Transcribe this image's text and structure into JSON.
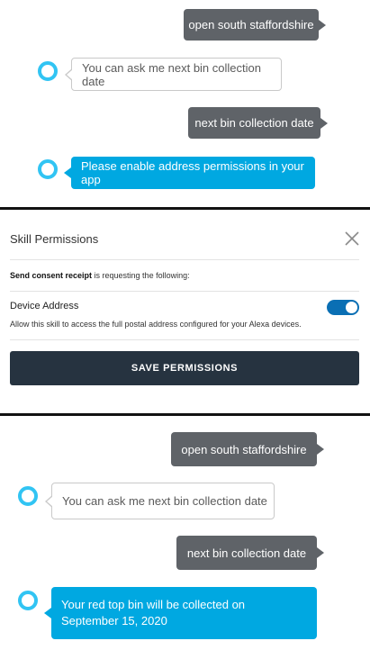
{
  "chat_top": {
    "user_msg_1": "open south staffordshire",
    "alexa_msg_1": "You can ask me next bin collection date",
    "user_msg_2": "next bin collection date",
    "alexa_msg_2": "Please enable address permissions in your app"
  },
  "permissions": {
    "title": "Skill Permissions",
    "skill_name": "Send consent receipt",
    "requesting_text": " is requesting the following:",
    "permission_name": "Device Address",
    "permission_desc": "Allow this skill to access the full postal address configured for your Alexa devices.",
    "toggle_on": true,
    "save_label": "SAVE PERMISSIONS"
  },
  "chat_bottom": {
    "user_msg_1": "open south staffordshire",
    "alexa_msg_1": "You can ask me next bin collection date",
    "user_msg_2": "next bin collection date",
    "alexa_msg_2_line1": "Your red top bin will be collected on",
    "alexa_msg_2_line2": "September 15, 2020"
  },
  "colors": {
    "user_bubble": "#5f6368",
    "alexa_blue_bubble": "#00a8e1",
    "alexa_ring": "#31c4f3",
    "toggle_on": "#0a6fb4",
    "save_button": "#263340"
  },
  "icons": {
    "alexa": "alexa-ring-icon",
    "close": "close-icon"
  }
}
